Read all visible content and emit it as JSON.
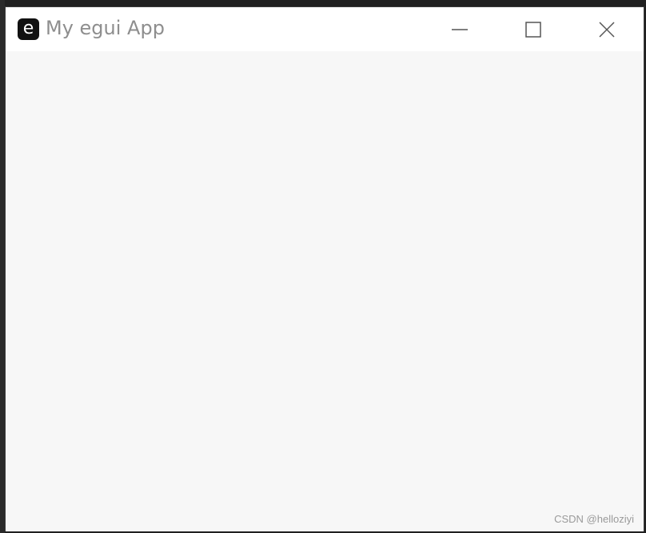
{
  "window": {
    "title": "My egui App",
    "icon_letter": "e",
    "icon_name": "egui-app-icon"
  },
  "caption_buttons": {
    "minimize": "minimize-icon",
    "maximize": "maximize-icon",
    "close": "close-icon"
  },
  "colors": {
    "titlebar_bg": "#ffffff",
    "content_bg": "#f7f7f7",
    "title_text": "#8e8e8e",
    "icon_bg": "#111111"
  },
  "watermark": {
    "text": "CSDN @helloziyi"
  }
}
